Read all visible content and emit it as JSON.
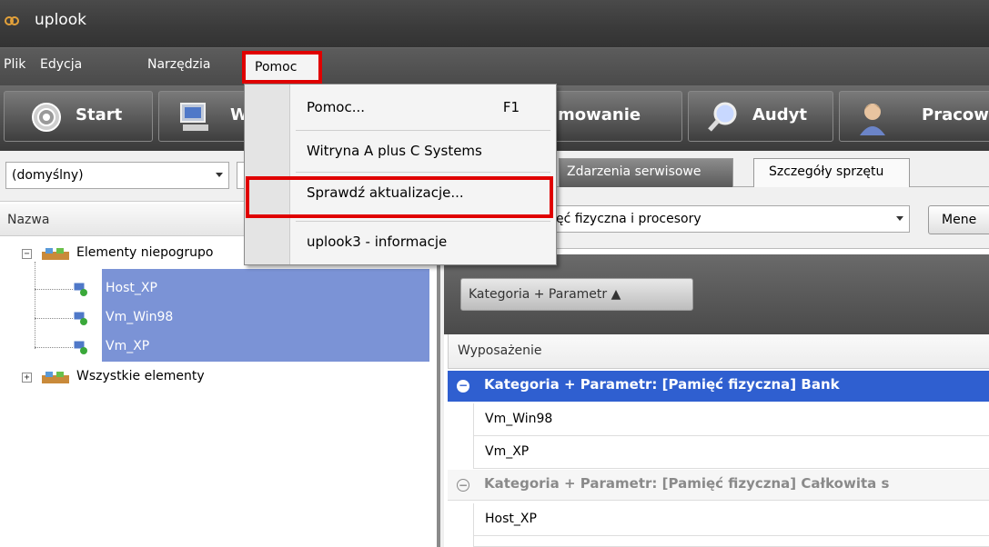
{
  "app": {
    "title": "uplook"
  },
  "menubar": {
    "items": [
      {
        "label": "Plik"
      },
      {
        "label": "Edycja"
      },
      {
        "label": "Narzędzia"
      },
      {
        "label": "Pomoc"
      }
    ]
  },
  "toolbar": {
    "buttons": [
      {
        "label": "Start",
        "icon": "start-icon"
      },
      {
        "label": "W",
        "icon": "computer-icon"
      },
      {
        "label": "mowanie",
        "icon": "planning-icon"
      },
      {
        "label": "Audyt",
        "icon": "magnifier-icon"
      },
      {
        "label": "Pracow",
        "icon": "person-icon"
      }
    ]
  },
  "left": {
    "view_combo": "(domyślny)",
    "column_header": "Nazwa",
    "tree": {
      "group1": "Elementy niepogrupo",
      "children": [
        "Host_XP",
        "Vm_Win98",
        "Vm_XP"
      ],
      "group2": "Wszystkie elementy"
    }
  },
  "right": {
    "tabs": [
      {
        "label": "Zdarzenia serwisowe",
        "active": false
      },
      {
        "label": "Szczegóły sprzętu",
        "active": true
      }
    ],
    "category_combo": "ęć fizyczna i procesory",
    "manage_button": "Mene",
    "group_chip": "Kategoria + Parametr ▲",
    "grid_header": "Wyposażenie",
    "groups": [
      {
        "label": "Kategoria + Parametr: [Pamięć fizyczna] Bank",
        "selected": true,
        "rows": [
          "Vm_Win98",
          "Vm_XP"
        ]
      },
      {
        "label": "Kategoria + Parametr: [Pamięć fizyczna] Całkowita s",
        "selected": false,
        "rows": [
          "Host_XP"
        ]
      }
    ]
  },
  "dropdown": {
    "items": [
      {
        "label": "Pomoc...",
        "shortcut": "F1"
      },
      {
        "label": "Witryna A plus C Systems",
        "shortcut": ""
      },
      {
        "label": "Sprawdź aktualizacje...",
        "shortcut": ""
      },
      {
        "label": "uplook3 - informacje",
        "shortcut": ""
      }
    ]
  },
  "colors": {
    "highlight": "#e00000",
    "selection": "#7b93d6",
    "group_selected": "#2f5fd0"
  }
}
